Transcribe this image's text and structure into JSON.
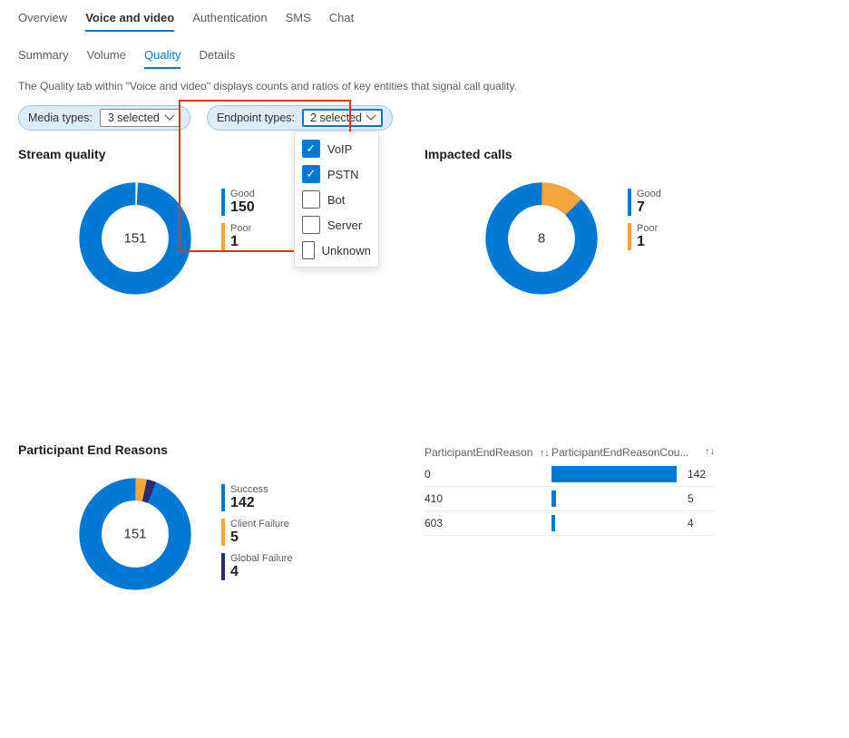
{
  "main_tabs": [
    "Overview",
    "Voice and video",
    "Authentication",
    "SMS",
    "Chat"
  ],
  "main_active": 1,
  "sub_tabs": [
    "Summary",
    "Volume",
    "Quality",
    "Details"
  ],
  "sub_active": 2,
  "description": "The Quality tab within \"Voice and video\" displays counts and ratios of key entities that signal call quality.",
  "filters": {
    "media_label": "Media types:",
    "media_value": "3 selected",
    "endpoint_label": "Endpoint types:",
    "endpoint_value": "2 selected",
    "endpoint_options": [
      {
        "label": "VoIP",
        "checked": true
      },
      {
        "label": "PSTN",
        "checked": true
      },
      {
        "label": "Bot",
        "checked": false
      },
      {
        "label": "Server",
        "checked": false
      },
      {
        "label": "Unknown",
        "checked": false
      }
    ]
  },
  "panels": {
    "stream_quality": {
      "title": "Stream quality",
      "total": "151",
      "legend": [
        {
          "label": "Good",
          "value": "150",
          "color": "#0078d4"
        },
        {
          "label": "Poor",
          "value": "1",
          "color": "#f2a53a"
        }
      ]
    },
    "impacted_calls": {
      "title": "Impacted calls",
      "total": "8",
      "legend": [
        {
          "label": "Good",
          "value": "7",
          "color": "#0078d4"
        },
        {
          "label": "Poor",
          "value": "1",
          "color": "#f2a53a"
        }
      ]
    },
    "end_reasons": {
      "title": "Participant End Reasons",
      "total": "151",
      "legend": [
        {
          "label": "Success",
          "value": "142",
          "color": "#0078d4"
        },
        {
          "label": "Client Failure",
          "value": "5",
          "color": "#f2a53a"
        },
        {
          "label": "Global Failure",
          "value": "4",
          "color": "#2d2a6e"
        }
      ]
    },
    "end_reasons_table": {
      "col1": "ParticipantEndReason",
      "col2": "ParticipantEndReasonCou...",
      "rows": [
        {
          "reason": "0",
          "count": "142",
          "pct": 100
        },
        {
          "reason": "410",
          "count": "5",
          "pct": 3.5
        },
        {
          "reason": "603",
          "count": "4",
          "pct": 2.8
        }
      ]
    }
  },
  "chart_data": [
    {
      "type": "pie",
      "title": "Stream quality",
      "categories": [
        "Good",
        "Poor"
      ],
      "values": [
        150,
        1
      ],
      "colors": [
        "#0078d4",
        "#f2a53a"
      ],
      "total": 151
    },
    {
      "type": "pie",
      "title": "Impacted calls",
      "categories": [
        "Good",
        "Poor"
      ],
      "values": [
        7,
        1
      ],
      "colors": [
        "#0078d4",
        "#f2a53a"
      ],
      "total": 8
    },
    {
      "type": "pie",
      "title": "Participant End Reasons",
      "categories": [
        "Success",
        "Client Failure",
        "Global Failure"
      ],
      "values": [
        142,
        5,
        4
      ],
      "colors": [
        "#0078d4",
        "#f2a53a",
        "#2d2a6e"
      ],
      "total": 151
    },
    {
      "type": "bar",
      "title": "ParticipantEndReason counts",
      "categories": [
        "0",
        "410",
        "603"
      ],
      "values": [
        142,
        5,
        4
      ],
      "xlabel": "ParticipantEndReason",
      "ylabel": "ParticipantEndReasonCount"
    }
  ]
}
